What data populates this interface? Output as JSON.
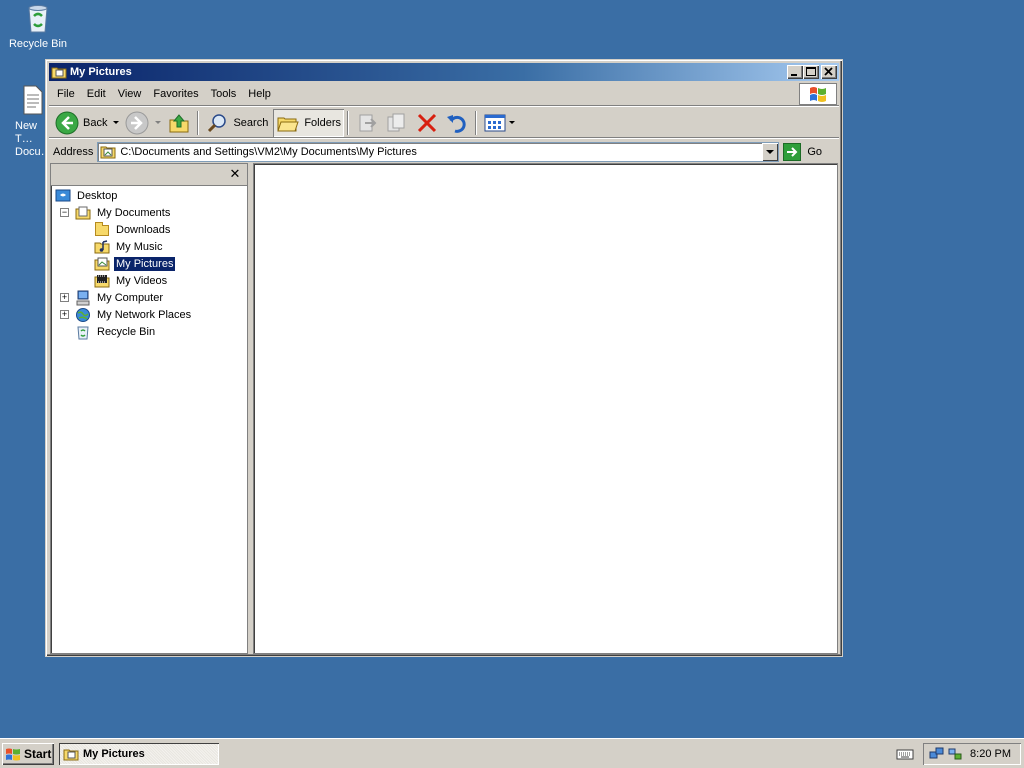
{
  "desktop": {
    "icons": [
      {
        "label": "Recycle Bin"
      },
      {
        "label": "New T… Docu…"
      }
    ]
  },
  "window": {
    "title": "My Pictures",
    "menu": [
      "File",
      "Edit",
      "View",
      "Favorites",
      "Tools",
      "Help"
    ],
    "toolbar": {
      "back_label": "Back",
      "search_label": "Search",
      "folders_label": "Folders"
    },
    "address": {
      "label": "Address",
      "value": "C:\\Documents and Settings\\VM2\\My Documents\\My Pictures",
      "go_label": "Go"
    },
    "tree": [
      {
        "label": "Desktop",
        "icon": "desktop-icon"
      },
      {
        "label": "My Documents",
        "icon": "my-documents-icon",
        "expander": "−"
      },
      {
        "label": "Downloads",
        "icon": "folder-icon"
      },
      {
        "label": "My Music",
        "icon": "music-folder-icon"
      },
      {
        "label": "My Pictures",
        "icon": "pictures-folder-icon",
        "selected": true
      },
      {
        "label": "My Videos",
        "icon": "video-folder-icon"
      },
      {
        "label": "My Computer",
        "icon": "computer-icon",
        "expander": "+"
      },
      {
        "label": "My Network Places",
        "icon": "network-icon",
        "expander": "+"
      },
      {
        "label": "Recycle Bin",
        "icon": "recycle-bin-icon"
      }
    ]
  },
  "taskbar": {
    "start_label": "Start",
    "task_label": "My Pictures",
    "clock": "8:20 PM"
  },
  "colors": {
    "desktop": "#3a6ea5",
    "title_active": "#0a246a",
    "selection": "#0a246a"
  }
}
